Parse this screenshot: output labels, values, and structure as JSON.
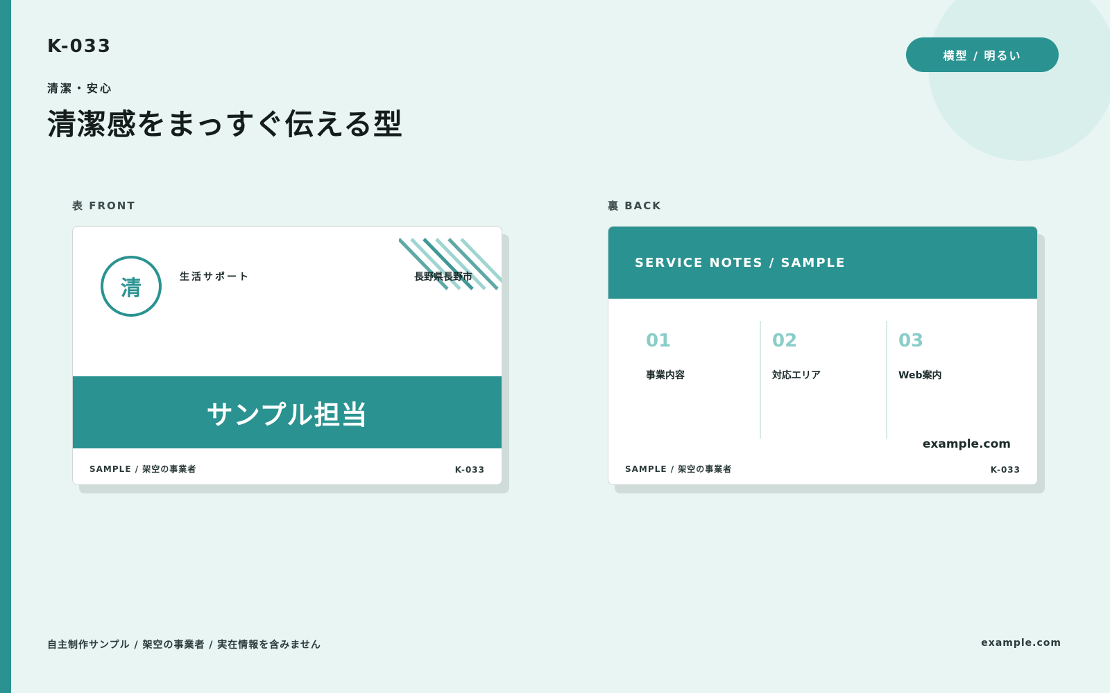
{
  "header": {
    "code": "K-033",
    "kicker": "清潔・安心",
    "headline": "清潔感をまっすぐ伝える型",
    "mode_badge": "横型 / 明るい"
  },
  "front": {
    "side_label": "表 FRONT",
    "logo_char": "清",
    "service_type": "生活サポート",
    "location": "長野県長野市",
    "person_name": "サンプル担当",
    "footer_left": "SAMPLE / 架空の事業者",
    "footer_right": "K-033"
  },
  "back": {
    "side_label": "裏 BACK",
    "header": "SERVICE NOTES / SAMPLE",
    "columns": [
      {
        "num": "01",
        "label": "事業内容"
      },
      {
        "num": "02",
        "label": "対応エリア"
      },
      {
        "num": "03",
        "label": "Web案内"
      }
    ],
    "url": "example.com",
    "footer_left": "SAMPLE / 架空の事業者",
    "footer_right": "K-033"
  },
  "footer": {
    "disclaimer": "自主制作サンプル / 架空の事業者 / 実在情報を含みません",
    "url": "example.com"
  },
  "colors": {
    "accent": "#2a9391",
    "accent_light": "#8acdc8",
    "background": "#e8f5f3",
    "card": "#ffffff"
  }
}
